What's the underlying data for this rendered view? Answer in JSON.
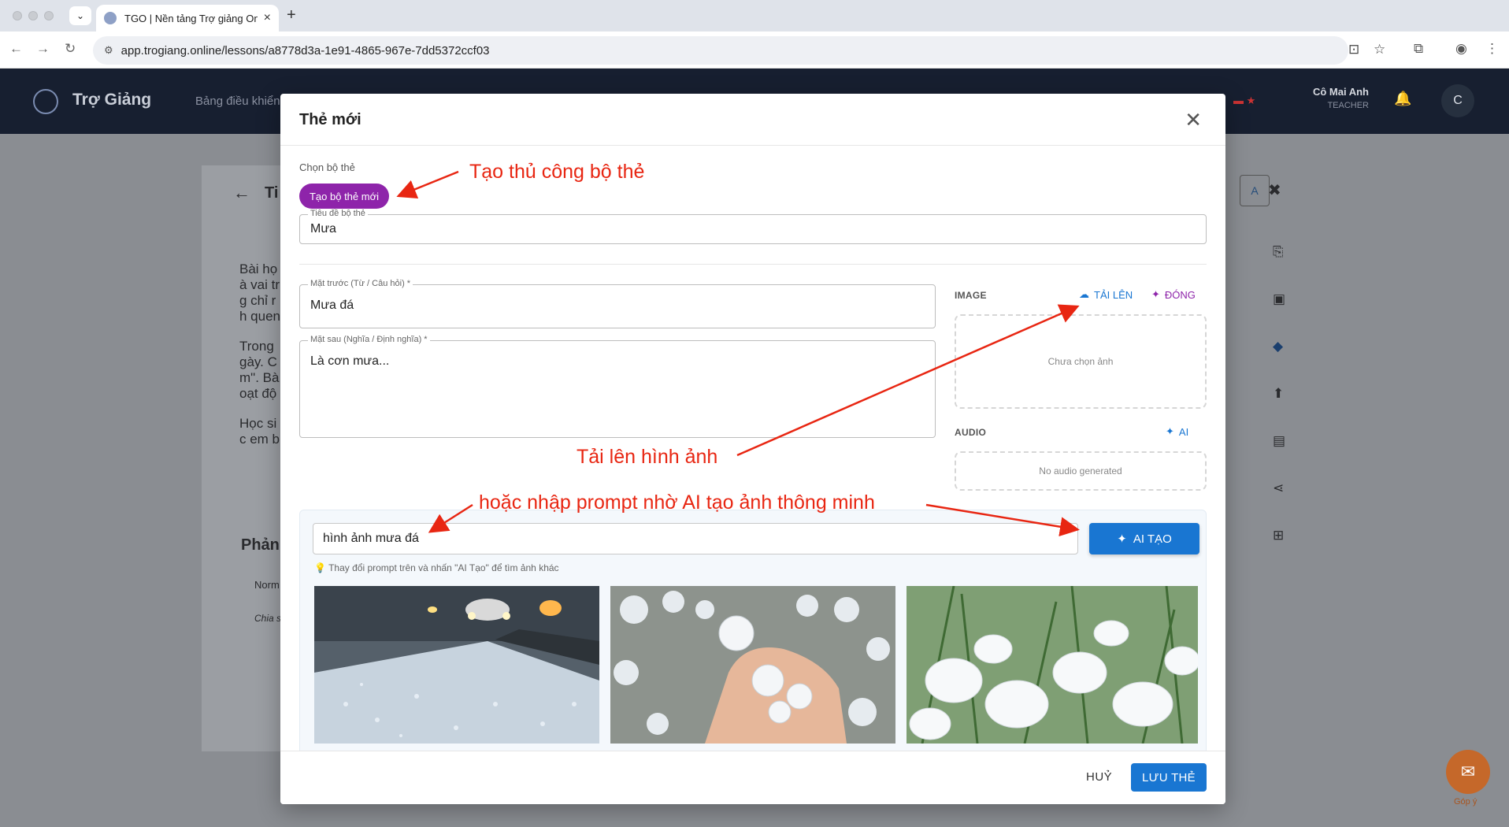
{
  "browser": {
    "tab_title": "TGO | Nền tảng Trợ giảng Onl",
    "url": "app.trogiang.online/lessons/a8778d3a-1e91-4865-967e-7dd5372ccf03"
  },
  "app": {
    "brand": "Trợ Giảng",
    "nav_link": "Bảng điều khiển",
    "user_name": "Cô Mai Anh",
    "user_role": "TEACHER",
    "avatar_letter": "C"
  },
  "background": {
    "page_title": "Ti",
    "right_btn": "A",
    "para1": [
      "Bài họ",
      "à vai tr",
      "g chỉ r",
      "h quen"
    ],
    "para2": [
      "Trong",
      "gày. C",
      "m\". Bà",
      "oạt độ"
    ],
    "para3": [
      "Học si",
      "c em b"
    ],
    "section": "Phản",
    "table_head": "Norm",
    "table_cell": "Chia s",
    "feedback_label": "Góp ý"
  },
  "modal": {
    "title": "Thẻ mới",
    "deck_label": "Chọn bộ thẻ",
    "new_deck_chip": "Tạo bộ thẻ mới",
    "deck_title_label": "Tiêu đề bộ thẻ",
    "deck_title_value": "Mưa",
    "front_label": "Mặt trước (Từ / Câu hỏi) *",
    "front_value": "Mưa đá",
    "back_label": "Mặt sau (Nghĩa / Định nghĩa) *",
    "back_value": "Là cơn mưa...",
    "image_heading": "IMAGE",
    "upload_label": "TẢI LÊN",
    "close_label": "ĐÓNG",
    "no_image": "Chưa chọn ảnh",
    "audio_heading": "AUDIO",
    "audio_ai_label": "AI",
    "no_audio": "No audio generated",
    "prompt_value": "hình ảnh mưa đá",
    "ai_button": "AI TẠO",
    "hint": "Thay đổi prompt trên và nhấn \"AI Tạo\" để tìm ảnh khác",
    "cancel": "HUỶ",
    "save": "LƯU THẺ"
  },
  "annotations": {
    "a1": "Tạo thủ công bộ thẻ",
    "a2": "Tải lên hình ảnh",
    "a3": "hoặc nhập prompt nhờ AI tạo ảnh thông minh"
  },
  "colors": {
    "primary": "#1976d2",
    "chip": "#8e24aa",
    "annotation": "#e82612",
    "header": "#171f30"
  }
}
